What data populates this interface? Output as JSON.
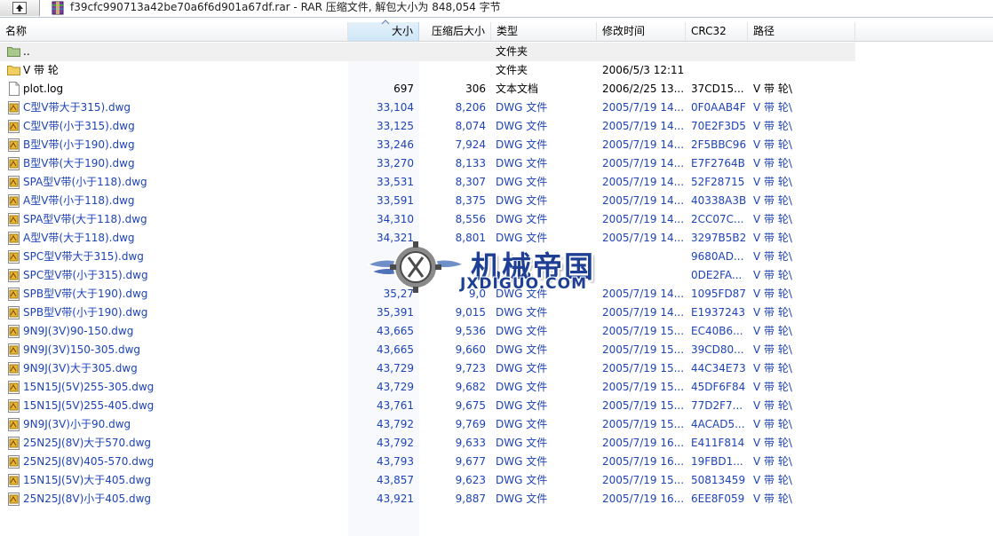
{
  "window": {
    "path_text": "f39cfc990713a42be70a6f6d901a67df.rar - RAR 压缩文件, 解包大小为 848,054 字节"
  },
  "columns": {
    "name": "名称",
    "size": "大小",
    "packed": "压缩后大小",
    "type": "类型",
    "modified": "修改时间",
    "crc": "CRC32",
    "path": "路径"
  },
  "rows": [
    {
      "icon": "folder-up-icon",
      "name": "..",
      "size": "",
      "packed": "",
      "type": "文件夹",
      "modified": "",
      "crc": "",
      "path": ""
    },
    {
      "icon": "folder-icon",
      "name": "V 带 轮",
      "size": "",
      "packed": "",
      "type": "文件夹",
      "modified": "2006/5/3 12:11",
      "crc": "",
      "path": ""
    },
    {
      "icon": "text-file-icon",
      "name": "plot.log",
      "size": "697",
      "packed": "306",
      "type": "文本文档",
      "modified": "2006/2/25 13...",
      "crc": "37CD15...",
      "path": "V 带 轮\\"
    },
    {
      "icon": "dwg-file-icon",
      "name": "C型V带大于315).dwg",
      "size": "33,104",
      "packed": "8,206",
      "type": "DWG 文件",
      "modified": "2005/7/19 14...",
      "crc": "0F0AAB4F",
      "path": "V 带 轮\\"
    },
    {
      "icon": "dwg-file-icon",
      "name": "C型V带(小于315).dwg",
      "size": "33,125",
      "packed": "8,074",
      "type": "DWG 文件",
      "modified": "2005/7/19 14...",
      "crc": "70E2F3D5",
      "path": "V 带 轮\\"
    },
    {
      "icon": "dwg-file-icon",
      "name": "B型V带(小于190).dwg",
      "size": "33,246",
      "packed": "7,924",
      "type": "DWG 文件",
      "modified": "2005/7/19 14...",
      "crc": "2F5BBC96",
      "path": "V 带 轮\\"
    },
    {
      "icon": "dwg-file-icon",
      "name": "B型V带(大于190).dwg",
      "size": "33,270",
      "packed": "8,133",
      "type": "DWG 文件",
      "modified": "2005/7/19 14...",
      "crc": "E7F2764B",
      "path": "V 带 轮\\"
    },
    {
      "icon": "dwg-file-icon",
      "name": "SPA型V带(小于118).dwg",
      "size": "33,531",
      "packed": "8,307",
      "type": "DWG 文件",
      "modified": "2005/7/19 14...",
      "crc": "52F28715",
      "path": "V 带 轮\\"
    },
    {
      "icon": "dwg-file-icon",
      "name": "A型V带(小于118).dwg",
      "size": "33,591",
      "packed": "8,375",
      "type": "DWG 文件",
      "modified": "2005/7/19 14...",
      "crc": "40338A3B",
      "path": "V 带 轮\\"
    },
    {
      "icon": "dwg-file-icon",
      "name": "SPA型V带(大于118).dwg",
      "size": "34,310",
      "packed": "8,556",
      "type": "DWG 文件",
      "modified": "2005/7/19 14...",
      "crc": "2CC07C...",
      "path": "V 带 轮\\"
    },
    {
      "icon": "dwg-file-icon",
      "name": "A型V带(大于118).dwg",
      "size": "34,321",
      "packed": "8,801",
      "type": "DWG 文件",
      "modified": "2005/7/19 14...",
      "crc": "3297B5B2",
      "path": "V 带 轮\\"
    },
    {
      "icon": "dwg-file-icon",
      "name": "SPC型V带大于315).dwg",
      "size": "",
      "packed": "",
      "type": "",
      "modified": "",
      "crc": "9680AD...",
      "path": "V 带 轮\\"
    },
    {
      "icon": "dwg-file-icon",
      "name": "SPC型V带(小于315).dwg",
      "size": "",
      "packed": "",
      "type": "",
      "modified": "",
      "crc": "0DE2FA...",
      "path": "V 带 轮\\"
    },
    {
      "icon": "dwg-file-icon",
      "name": "SPB型V带(大于190).dwg",
      "size": "35,27",
      "packed": "9,0",
      "type": "DWG 文件",
      "modified": "2005/7/19 14...",
      "crc": "1095FD87",
      "path": "V 带 轮\\"
    },
    {
      "icon": "dwg-file-icon",
      "name": "SPB型V带(小于190).dwg",
      "size": "35,391",
      "packed": "9,015",
      "type": "DWG 文件",
      "modified": "2005/7/19 14...",
      "crc": "E1937243",
      "path": "V 带 轮\\"
    },
    {
      "icon": "dwg-file-icon",
      "name": "9N9J(3V)90-150.dwg",
      "size": "43,665",
      "packed": "9,536",
      "type": "DWG 文件",
      "modified": "2005/7/19 15...",
      "crc": "EC40B6...",
      "path": "V 带 轮\\"
    },
    {
      "icon": "dwg-file-icon",
      "name": "9N9J(3V)150-305.dwg",
      "size": "43,665",
      "packed": "9,660",
      "type": "DWG 文件",
      "modified": "2005/7/19 15...",
      "crc": "39CD80...",
      "path": "V 带 轮\\"
    },
    {
      "icon": "dwg-file-icon",
      "name": "9N9J(3V)大于305.dwg",
      "size": "43,729",
      "packed": "9,723",
      "type": "DWG 文件",
      "modified": "2005/7/19 15...",
      "crc": "44C34E73",
      "path": "V 带 轮\\"
    },
    {
      "icon": "dwg-file-icon",
      "name": "15N15J(5V)255-305.dwg",
      "size": "43,729",
      "packed": "9,682",
      "type": "DWG 文件",
      "modified": "2005/7/19 15...",
      "crc": "45DF6F84",
      "path": "V 带 轮\\"
    },
    {
      "icon": "dwg-file-icon",
      "name": "15N15J(5V)255-405.dwg",
      "size": "43,761",
      "packed": "9,675",
      "type": "DWG 文件",
      "modified": "2005/7/19 15...",
      "crc": "77D2F7...",
      "path": "V 带 轮\\"
    },
    {
      "icon": "dwg-file-icon",
      "name": "9N9J(3V)小于90.dwg",
      "size": "43,792",
      "packed": "9,769",
      "type": "DWG 文件",
      "modified": "2005/7/19 15...",
      "crc": "4ACAD5...",
      "path": "V 带 轮\\"
    },
    {
      "icon": "dwg-file-icon",
      "name": "25N25J(8V)大于570.dwg",
      "size": "43,792",
      "packed": "9,633",
      "type": "DWG 文件",
      "modified": "2005/7/19 16...",
      "crc": "E411F814",
      "path": "V 带 轮\\"
    },
    {
      "icon": "dwg-file-icon",
      "name": "25N25J(8V)405-570.dwg",
      "size": "43,793",
      "packed": "9,677",
      "type": "DWG 文件",
      "modified": "2005/7/19 16...",
      "crc": "19FBD1...",
      "path": "V 带 轮\\"
    },
    {
      "icon": "dwg-file-icon",
      "name": "15N15J(5V)大于405.dwg",
      "size": "43,857",
      "packed": "9,623",
      "type": "DWG 文件",
      "modified": "2005/7/19 15...",
      "crc": "50813459",
      "path": "V 带 轮\\"
    },
    {
      "icon": "dwg-file-icon",
      "name": "25N25J(8V)小于405.dwg",
      "size": "43,921",
      "packed": "9,887",
      "type": "DWG 文件",
      "modified": "2005/7/19 16...",
      "crc": "6EE8F059",
      "path": "V 带 轮\\"
    }
  ],
  "watermark": {
    "title": "机械帝国",
    "url": "JXDIGUO.COM"
  },
  "colors": {
    "link_blue": "#1d43b7",
    "sorted_header": "#cfe6f7",
    "watermark_blue": "#1e3f93"
  }
}
